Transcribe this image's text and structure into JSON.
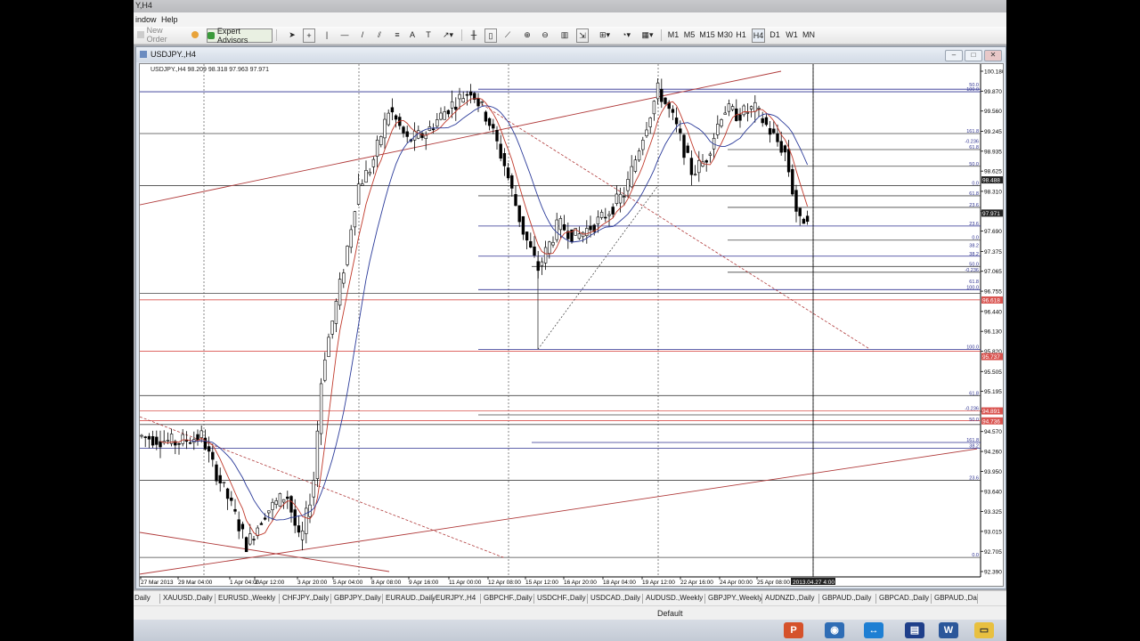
{
  "window": {
    "title": "Y,H4"
  },
  "menu": {
    "items": [
      "indow",
      "Help"
    ]
  },
  "toolbar": {
    "new_order": "New Order",
    "expert_advisors": "Expert Advisors",
    "timeframes": [
      "M1",
      "M5",
      "M15",
      "M30",
      "H1",
      "H4",
      "D1",
      "W1",
      "MN"
    ],
    "active_timeframe": "H4"
  },
  "chart_window": {
    "title": "USDJPY.,H4",
    "info": "USDJPY.,H4  98.209 98.318 97.963 97.971"
  },
  "chart_data": {
    "type": "candlestick",
    "symbol": "USDJPY.",
    "timeframe": "H4",
    "price_axis": [
      "100.180",
      "99.870",
      "99.560",
      "99.245",
      "98.935",
      "98.625",
      "98.310",
      "98.000",
      "97.690",
      "97.375",
      "97.065",
      "96.755",
      "96.440",
      "96.130",
      "95.820",
      "95.505",
      "95.195",
      "94.885",
      "94.570",
      "94.260",
      "93.950",
      "93.640",
      "93.325",
      "93.015",
      "92.705",
      "92.390"
    ],
    "price_range": [
      92.39,
      100.18
    ],
    "time_axis": [
      "27 Mar 2013",
      "29 Mar 04:00",
      "1 Apr 04:00",
      "2 Apr 12:00",
      "3 Apr 20:00",
      "5 Apr 04:00",
      "8 Apr 08:00",
      "9 Apr 16:00",
      "11 Apr 00:00",
      "12 Apr 08:00",
      "15 Apr 12:00",
      "16 Apr 20:00",
      "18 Apr 04:00",
      "19 Apr 12:00",
      "22 Apr 16:00",
      "24 Apr 00:00",
      "25 Apr 08:00"
    ],
    "crosshair_time": "2013.04.27 4:00",
    "current_price_label": "97.971",
    "crosshair_price_label": "98.488",
    "red_level_labels": [
      "96.618",
      "95.737",
      "94.891",
      "94.736"
    ],
    "level_labels": [
      {
        "text": "50.0",
        "price": 99.93
      },
      {
        "text": "100.0",
        "price": 99.86
      },
      {
        "text": "161.8",
        "price": 99.21
      },
      {
        "text": "-0.236",
        "price": 99.05
      },
      {
        "text": "61.8",
        "price": 98.96
      },
      {
        "text": "50.0",
        "price": 98.7
      },
      {
        "text": "0.0",
        "price": 98.4
      },
      {
        "text": "61.8",
        "price": 98.24
      },
      {
        "text": "23.6",
        "price": 98.06
      },
      {
        "text": "23.6",
        "price": 97.77
      },
      {
        "text": "0.0",
        "price": 97.55
      },
      {
        "text": "38.2",
        "price": 97.43
      },
      {
        "text": "38.2",
        "price": 97.3
      },
      {
        "text": "50.0",
        "price": 97.14
      },
      {
        "text": "-0.236",
        "price": 97.05
      },
      {
        "text": "61.8",
        "price": 96.87
      },
      {
        "text": "100.0",
        "price": 96.78
      },
      {
        "text": "100.0",
        "price": 95.85
      },
      {
        "text": "61.8",
        "price": 95.13
      },
      {
        "text": "-0.236",
        "price": 94.89
      },
      {
        "text": "50.0",
        "price": 94.72
      },
      {
        "text": "161.8",
        "price": 94.4
      },
      {
        "text": "38.2",
        "price": 94.31
      },
      {
        "text": "23.6",
        "price": 93.81
      },
      {
        "text": "0.0",
        "price": 92.61
      }
    ]
  },
  "symbol_tabs": [
    "Daily",
    "XAUUSD.,Daily",
    "EURUSD.,Weekly",
    "CHFJPY.,Daily",
    "GBPJPY.,Daily",
    "EURAUD.,Daily",
    "EURJPY.,H4",
    "GBPCHF.,Daily",
    "USDCHF.,Daily",
    "USDCAD.,Daily",
    "AUDUSD.,Weekly",
    "GBPJPY.,Weekly",
    "AUDNZD.,Daily",
    "GBPAUD.,Daily",
    "GBPCAD.,Daily",
    "GBPAUD.,Da"
  ],
  "status": {
    "profile": "Default"
  },
  "colors": {
    "bull": "#ffffff",
    "bear": "#000000",
    "ma_fast": "#c0392b",
    "ma_slow": "#2b3b9a",
    "level_red": "#d9534f",
    "level_navy": "#2b2f8f"
  }
}
